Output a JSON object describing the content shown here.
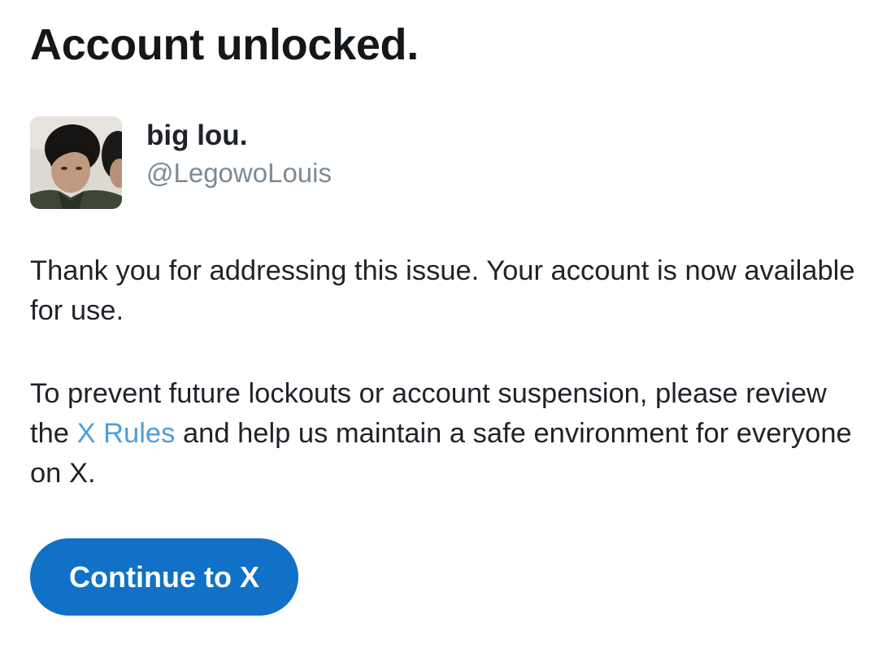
{
  "page": {
    "title": "Account unlocked."
  },
  "account": {
    "display_name": "big lou.",
    "handle": "@LegowoLouis"
  },
  "message": {
    "paragraph1": "Thank you for addressing this issue. Your account is now available for use.",
    "paragraph2_before": "To prevent future lockouts or account suspension, please review the ",
    "rules_link": "X Rules",
    "paragraph2_after": " and help us maintain a safe environment for everyone on X."
  },
  "actions": {
    "continue_label": "Continue to X"
  },
  "colors": {
    "primary_button": "#1071c7",
    "link": "#4b9fd8",
    "handle_text": "#7d8a94",
    "body_text": "#1f2329"
  }
}
